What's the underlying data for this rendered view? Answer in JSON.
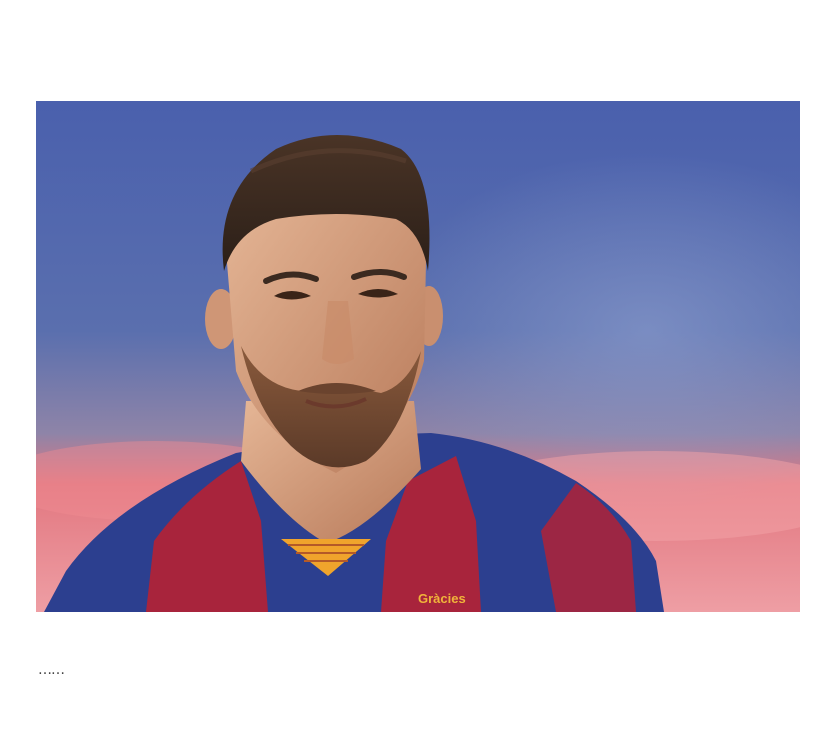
{
  "post": {
    "photo": {
      "subject": "football-player-portrait",
      "jersey_sponsor_text": "Gràcies",
      "colors": {
        "background_sky": "#4f63a8",
        "background_crowd": "#e36a74",
        "jersey_blue": "#2c3f8f",
        "jersey_red": "#a8243c",
        "collar_gold": "#f0a42c",
        "skin": "#d6a07f",
        "hair": "#3a2a20"
      }
    },
    "caption": "……"
  }
}
